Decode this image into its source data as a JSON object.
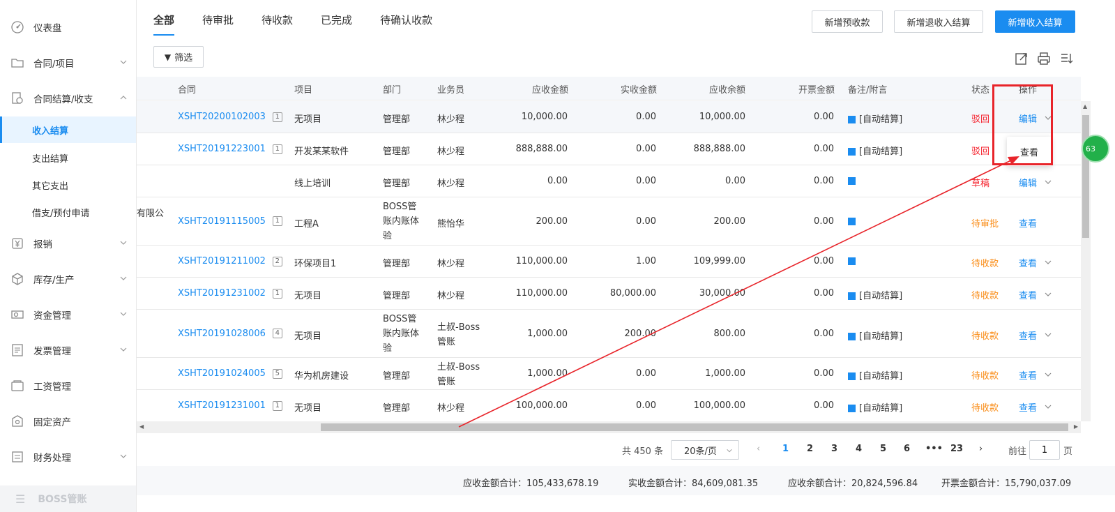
{
  "sidebar": {
    "items": [
      {
        "label": "仪表盘",
        "icon": "dashboard-icon"
      },
      {
        "label": "合同/项目",
        "icon": "folder-icon"
      },
      {
        "label": "合同结算/收支",
        "icon": "settlement-icon"
      },
      {
        "label": "报销",
        "icon": "yen-icon"
      },
      {
        "label": "库存/生产",
        "icon": "box-icon"
      },
      {
        "label": "资金管理",
        "icon": "money-icon"
      },
      {
        "label": "发票管理",
        "icon": "invoice-icon"
      },
      {
        "label": "工资管理",
        "icon": "wallet-icon"
      },
      {
        "label": "固定资产",
        "icon": "asset-icon"
      },
      {
        "label": "财务处理",
        "icon": "finance-icon"
      }
    ],
    "sub_items": [
      "收入结算",
      "支出结算",
      "其它支出",
      "借支/预付申请"
    ],
    "footer": "BOSS管账"
  },
  "tabs": [
    "全部",
    "待审批",
    "待收款",
    "已完成",
    "待确认收款"
  ],
  "buttons": {
    "new_prepay": "新增预收款",
    "new_refund": "新增退收入结算",
    "new_income": "新增收入结算",
    "filter": "筛选"
  },
  "table": {
    "headers": [
      "合同",
      "项目",
      "部门",
      "业务员",
      "应收金额",
      "实收金额",
      "应收余额",
      "开票金额",
      "备注/附言",
      "状态",
      "操作"
    ],
    "rows": [
      {
        "prefix": "",
        "contract": "XSHT20200102003",
        "count": "1",
        "project": "无项目",
        "dept": "管理部",
        "staff": "林少程",
        "recv": "10,000.00",
        "actual": "0.00",
        "balance": "10,000.00",
        "invoice": "0.00",
        "note": "[自动结算]",
        "status": "驳回",
        "op": "编辑"
      },
      {
        "prefix": "",
        "contract": "XSHT20191223001",
        "count": "1",
        "project": "开发某某软件",
        "dept": "管理部",
        "staff": "林少程",
        "recv": "888,888.00",
        "actual": "0.00",
        "balance": "888,888.00",
        "invoice": "0.00",
        "note": "[自动结算]",
        "status": "驳回",
        "op": ""
      },
      {
        "prefix": "",
        "contract": "",
        "count": "",
        "project": "线上培训",
        "dept": "管理部",
        "staff": "林少程",
        "recv": "0.00",
        "actual": "0.00",
        "balance": "0.00",
        "invoice": "0.00",
        "note": "",
        "status": "草稿",
        "op": "编辑"
      },
      {
        "prefix": "有限公",
        "contract": "XSHT20191115005",
        "count": "1",
        "project": "工程A",
        "dept": "BOSS管账内账体验",
        "staff": "熊怡华",
        "recv": "200.00",
        "actual": "0.00",
        "balance": "200.00",
        "invoice": "0.00",
        "note": "",
        "status": "待审批",
        "op": "查看"
      },
      {
        "prefix": "",
        "contract": "XSHT20191211002",
        "count": "2",
        "project": "环保项目1",
        "dept": "管理部",
        "staff": "林少程",
        "recv": "110,000.00",
        "actual": "1.00",
        "balance": "109,999.00",
        "invoice": "0.00",
        "note": "",
        "status": "待收款",
        "op": "查看"
      },
      {
        "prefix": "",
        "contract": "XSHT20191231002",
        "count": "1",
        "project": "无项目",
        "dept": "管理部",
        "staff": "林少程",
        "recv": "110,000.00",
        "actual": "80,000.00",
        "balance": "30,000.00",
        "invoice": "0.00",
        "note": "[自动结算]",
        "status": "待收款",
        "op": "查看"
      },
      {
        "prefix": "",
        "contract": "XSHT20191028006",
        "count": "4",
        "project": "无项目",
        "dept": "BOSS管账内账体验",
        "staff": "土叔-Boss管账",
        "recv": "1,000.00",
        "actual": "200.00",
        "balance": "800.00",
        "invoice": "0.00",
        "note": "[自动结算]",
        "status": "待收款",
        "op": "查看"
      },
      {
        "prefix": "",
        "contract": "XSHT20191024005",
        "count": "5",
        "project": "华为机房建设",
        "dept": "管理部",
        "staff": "土叔-Boss管账",
        "recv": "1,000.00",
        "actual": "0.00",
        "balance": "1,000.00",
        "invoice": "0.00",
        "note": "[自动结算]",
        "status": "待收款",
        "op": "查看"
      },
      {
        "prefix": "",
        "contract": "XSHT20191231001",
        "count": "1",
        "project": "无项目",
        "dept": "管理部",
        "staff": "林少程",
        "recv": "100,000.00",
        "actual": "0.00",
        "balance": "100,000.00",
        "invoice": "0.00",
        "note": "[自动结算]",
        "status": "待收款",
        "op": "查看"
      }
    ]
  },
  "dropdown": {
    "item": "查看"
  },
  "pagination": {
    "total": "共 450 条",
    "page_size": "20条/页",
    "pages": [
      "1",
      "2",
      "3",
      "4",
      "5",
      "6",
      "•••",
      "23"
    ],
    "current": "1",
    "goto_label": "前往",
    "goto_value": "1",
    "goto_unit": "页"
  },
  "summary": {
    "recv_total": "应收金额合计：105,433,678.19",
    "actual_total": "实收金额合计：84,609,081.35",
    "balance_total": "应收余额合计：20,824,596.84",
    "invoice_total": "开票金额合计：15,790,037.09"
  },
  "side_badge": "63",
  "colors": {
    "accent": "#1a8cf0",
    "red": "#f5222d",
    "orange": "#fa8c16",
    "annotation": "#e8242a"
  }
}
